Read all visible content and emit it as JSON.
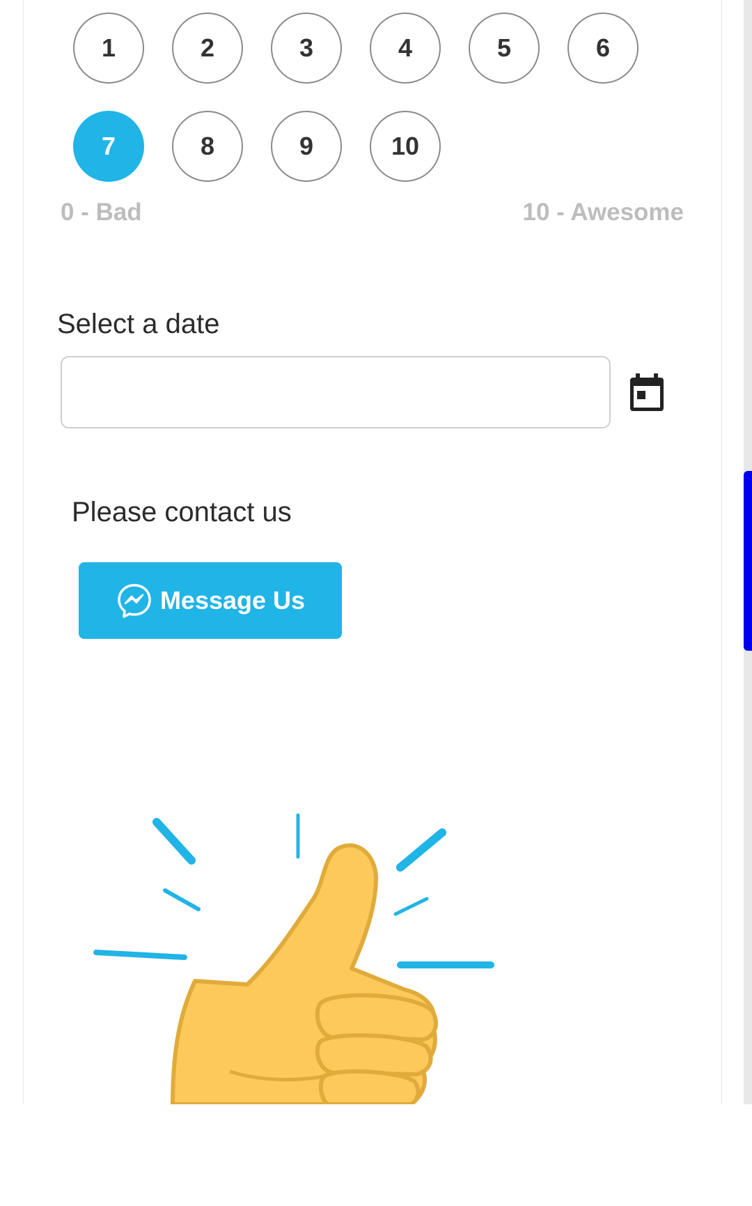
{
  "rating": {
    "options": [
      "1",
      "2",
      "3",
      "4",
      "5",
      "6",
      "7",
      "8",
      "9",
      "10"
    ],
    "selected": "7",
    "low_label": "0 - Bad",
    "high_label": "10 - Awesome",
    "accent_color": "#21b4e6"
  },
  "date_field": {
    "label": "Select a date",
    "value": "",
    "icon": "calendar-icon"
  },
  "contact": {
    "heading": "Please contact us",
    "button_label": "Message Us",
    "button_icon": "messenger-icon",
    "button_color": "#21b4e6"
  },
  "illustration": {
    "icon": "thumbs-up-icon"
  }
}
